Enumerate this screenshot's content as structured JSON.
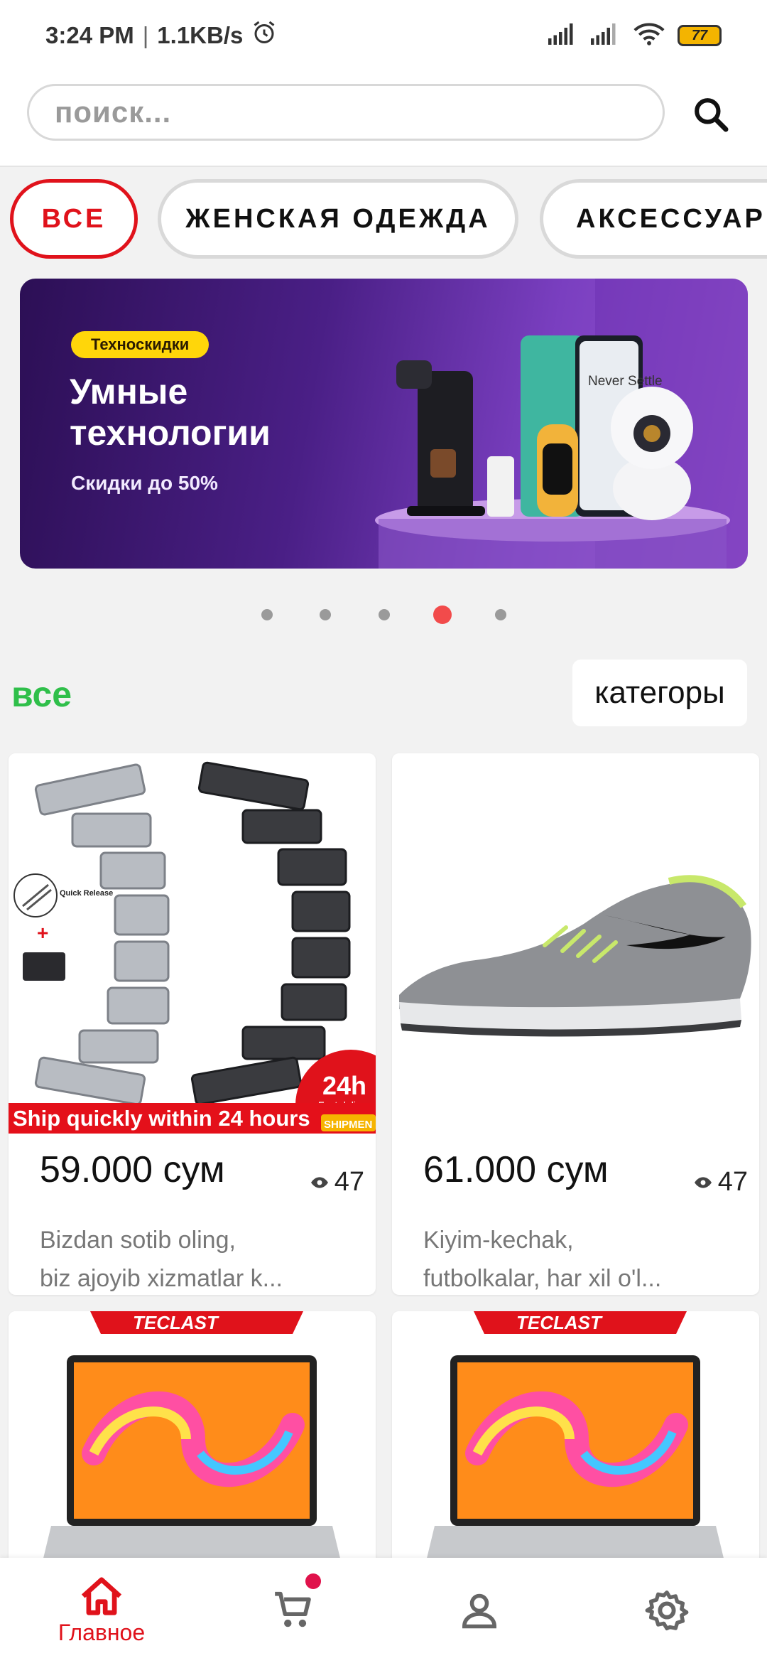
{
  "status_bar": {
    "time": "3:24 PM",
    "separator": "|",
    "speed": "1.1KB/s",
    "battery": "77",
    "icons": [
      "alarm-icon",
      "signal-icon",
      "signal-icon",
      "wifi-icon",
      "battery-icon"
    ]
  },
  "search": {
    "placeholder": "поиск...",
    "icon": "search-icon"
  },
  "chips": [
    {
      "label": "ВСЕ",
      "active": true
    },
    {
      "label": "ЖЕНСКАЯ ОДЕЖДА",
      "active": false
    },
    {
      "label": "АКСЕССУАРЫ",
      "active": false
    }
  ],
  "banner": {
    "tag": "Техноскидки",
    "title": "Умные технологии",
    "subtitle": "Скидки до 50%",
    "phone_text": "Never Settle",
    "slide_index": 4,
    "slide_count": 5,
    "accent": "#ffd60a"
  },
  "section": {
    "title": "все",
    "categories_button": "категоры",
    "title_color": "#2fbf4a"
  },
  "products": [
    {
      "price": "59.000 сум",
      "views": "47",
      "desc_line1": "Bizdan sotib oling,",
      "desc_line2": "biz ajoyib xizmatlar k...",
      "image": "watch-band-image",
      "image_caption": "Ship quickly within 24 hours",
      "badge_big": "24h",
      "badge_small": "Fast deliver",
      "badge_bottom": "SHIPMEN",
      "quick_release": "Quick Release"
    },
    {
      "price": "61.000 сум",
      "views": "47",
      "desc_line1": "Kiyim-kechak,",
      "desc_line2": "futbolkalar, har xil o'l...",
      "image": "sneaker-image"
    },
    {
      "image": "laptop-image",
      "brand": "TECLAST"
    },
    {
      "image": "laptop-image",
      "brand": "TECLAST"
    }
  ],
  "bottom_nav": [
    {
      "label": "Главное",
      "icon": "home-icon",
      "active": true
    },
    {
      "label": "",
      "icon": "cart-icon",
      "active": false,
      "has_badge": true
    },
    {
      "label": "",
      "icon": "user-icon",
      "active": false
    },
    {
      "label": "",
      "icon": "settings-icon",
      "active": false
    }
  ],
  "colors": {
    "brand_red": "#e0121b",
    "dot_active": "#f24b4b"
  }
}
